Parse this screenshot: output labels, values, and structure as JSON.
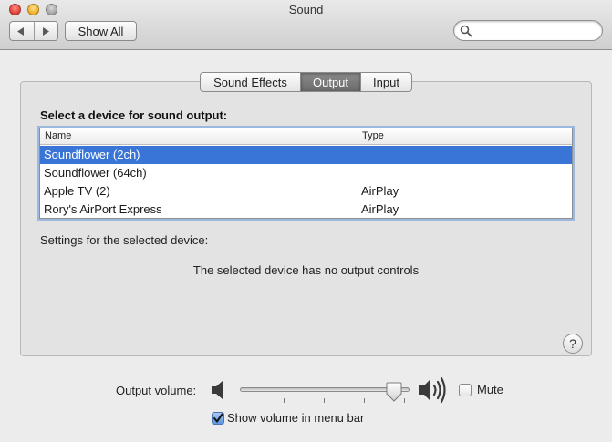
{
  "window": {
    "title": "Sound"
  },
  "toolbar": {
    "back_icon": "triangle-left",
    "forward_icon": "triangle-right",
    "show_all_label": "Show All",
    "search": {
      "value": "",
      "placeholder": ""
    }
  },
  "tabs": [
    {
      "label": "Sound Effects",
      "active": false
    },
    {
      "label": "Output",
      "active": true
    },
    {
      "label": "Input",
      "active": false
    }
  ],
  "output": {
    "heading": "Select a device for sound output:",
    "columns": {
      "name": "Name",
      "type": "Type"
    },
    "devices": [
      {
        "name": "Soundflower (2ch)",
        "type": "",
        "selected": true
      },
      {
        "name": "Soundflower (64ch)",
        "type": "",
        "selected": false
      },
      {
        "name": "Apple TV (2)",
        "type": "AirPlay",
        "selected": false
      },
      {
        "name": "Rory's AirPort Express",
        "type": "AirPlay",
        "selected": false
      }
    ],
    "settings_label": "Settings for the selected device:",
    "no_controls_message": "The selected device has no output controls",
    "help_label": "?"
  },
  "volume": {
    "label": "Output volume:",
    "level": 0.95,
    "mute_label": "Mute",
    "muted": false,
    "show_in_menu_bar_label": "Show volume in menu bar",
    "show_in_menu_bar": true
  },
  "colors": {
    "selection": "#3875d7",
    "active_tab": "#7a7a7a",
    "focus_ring": "#9cb8dc"
  }
}
